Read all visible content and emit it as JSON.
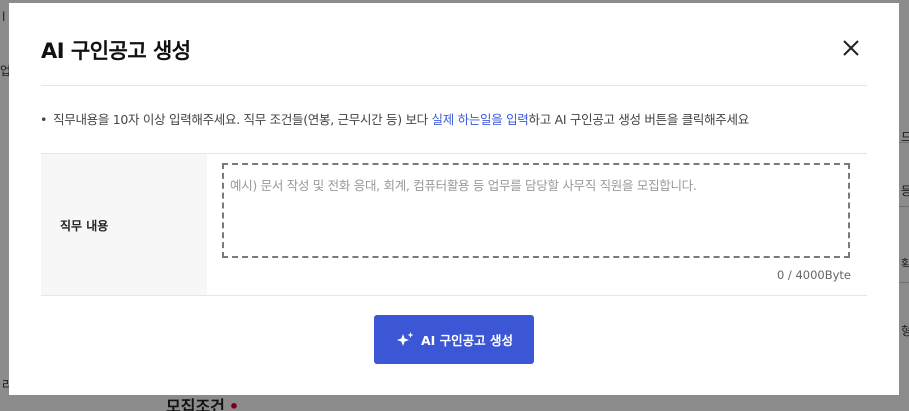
{
  "background": {
    "left_fragments": [
      "l",
      "업)",
      "라"
    ],
    "right_fragments": [
      "드",
      "등",
      "확",
      "형"
    ],
    "bottom_title": "모집조건",
    "required_mark": "•"
  },
  "modal": {
    "title": "AI 구인공고 생성",
    "close_icon": "close-icon",
    "notice": {
      "bullet": "•",
      "before": "직무내용을 10자 이상 입력해주세요. 직무 조건들(연봉, 근무시간 등) 보다 ",
      "highlight": "실제 하는일을 입력",
      "after": "하고 AI 구인공고 생성 버튼을 클릭해주세요"
    },
    "field": {
      "label": "직무 내용",
      "placeholder": "예시) 문서 작성 및 전화 응대, 회계, 컴퓨터활용 등 업무를 담당할 사무직 직원을 모집합니다.",
      "value": "",
      "byte_count": "0 / 4000Byte"
    },
    "submit_button": {
      "label": "AI 구인공고 생성",
      "icon": "sparkle-icon"
    }
  },
  "colors": {
    "accent": "#3b57d6",
    "highlight_text": "#3b5bdb",
    "label_bg": "#f7f7f7"
  }
}
